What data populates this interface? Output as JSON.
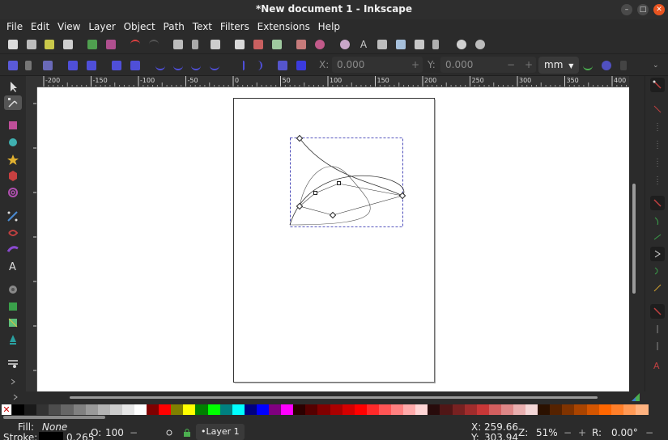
{
  "window": {
    "title": "*New document 1 - Inkscape",
    "minimize_glyph": "–",
    "maximize_glyph": "□",
    "close_glyph": "✕"
  },
  "menu": [
    "File",
    "Edit",
    "View",
    "Layer",
    "Object",
    "Path",
    "Text",
    "Filters",
    "Extensions",
    "Help"
  ],
  "node_toolbar": {
    "x_label": "X:",
    "x_value": "0.000",
    "y_label": "Y:",
    "y_value": "0.000",
    "minus": "−",
    "plus": "+",
    "unit": "mm"
  },
  "ruler": {
    "labels": [
      "-200",
      "-150",
      "-100",
      "-50",
      "0",
      "50",
      "100",
      "150",
      "200",
      "250",
      "300",
      "350",
      "400"
    ]
  },
  "palette": {
    "none_glyph": "✕",
    "colors": [
      "#000000",
      "#1a1a1a",
      "#333333",
      "#4d4d4d",
      "#666666",
      "#808080",
      "#999999",
      "#b3b3b3",
      "#cccccc",
      "#e6e6e6",
      "#ffffff",
      "#800000",
      "#ff0000",
      "#808000",
      "#ffff00",
      "#008000",
      "#00ff00",
      "#008080",
      "#00ffff",
      "#000080",
      "#0000ff",
      "#800080",
      "#ff00ff",
      "#2b0000",
      "#550000",
      "#800000",
      "#aa0000",
      "#d40000",
      "#ff0000",
      "#ff2a2a",
      "#ff5555",
      "#ff8080",
      "#ffaaaa",
      "#ffd5d5",
      "#280b0b",
      "#501616",
      "#782121",
      "#a02c2c",
      "#c83737",
      "#d35f5f",
      "#de8787",
      "#e9afaf",
      "#f4d7d7",
      "#2b1100",
      "#552200",
      "#803300",
      "#aa4400",
      "#d45500",
      "#ff6600",
      "#ff7f2a",
      "#ff9955",
      "#ffb380"
    ]
  },
  "status": {
    "fill_label": "Fill:",
    "fill_value": "None",
    "stroke_label": "Stroke:",
    "stroke_width": "0.265",
    "opacity_label": "O:",
    "opacity_value": "100",
    "opacity_minus": "−",
    "layer_name": "•Layer 1",
    "x_label": "X:",
    "x_value": "259.66",
    "y_label": "Y:",
    "y_value": "303.94",
    "zoom_label": "Z:",
    "zoom_value": "51%",
    "zoom_minus": "−",
    "zoom_plus": "+",
    "rotate_label": "R:",
    "rotate_value": "0.00°",
    "rotate_minus": "−"
  },
  "colors": {
    "ui_bg": "#2b2b2b",
    "canvas_bg": "#ffffff",
    "accent_close": "#e95420",
    "selection_dash": "#2222aa"
  }
}
